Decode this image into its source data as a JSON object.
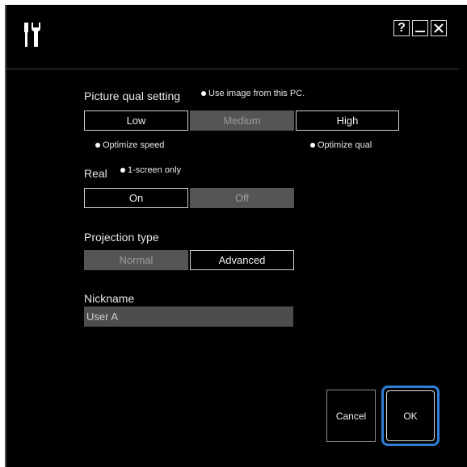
{
  "titlebar": {
    "app_icon": "tools-icon",
    "help_label": "?",
    "minimize_label": "—",
    "close_label": "✕"
  },
  "picture_quality": {
    "label": "Picture qual setting",
    "note": "Use image from this PC.",
    "options": [
      "Low",
      "Medium",
      "High"
    ],
    "selected": "Medium",
    "speed_note": "Optimize speed",
    "quality_note": "Optimize qual"
  },
  "real": {
    "label": "Real",
    "note": "1-screen only",
    "options": [
      "On",
      "Off"
    ],
    "selected": "Off"
  },
  "projection": {
    "label": "Projection type",
    "options": [
      "Normal",
      "Advanced"
    ],
    "selected": "Normal"
  },
  "nickname": {
    "label": "Nickname",
    "value": "User A"
  },
  "buttons": {
    "cancel": "Cancel",
    "ok": "OK"
  },
  "colors": {
    "background": "#000000",
    "selected_segment": "#555555",
    "focus_ring": "#2f7fd8"
  }
}
